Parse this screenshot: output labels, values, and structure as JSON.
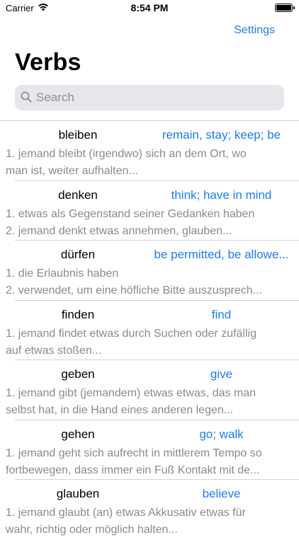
{
  "status_bar": {
    "carrier": "Carrier",
    "time": "8:54 PM"
  },
  "nav": {
    "settings_label": "Settings",
    "title": "Verbs"
  },
  "search": {
    "placeholder": "Search",
    "value": ""
  },
  "verbs": [
    {
      "word": "bleiben",
      "translation": "remain, stay; keep; be",
      "line1": "1. jemand bleibt (irgendwo) sich an dem Ort, wo",
      "line2": "man ist, weiter aufhalten..."
    },
    {
      "word": "denken",
      "translation": "think; have in mind",
      "line1": "1. etwas als Gegenstand seiner Gedanken haben",
      "line2": "2. jemand denkt etwas annehmen, glauben..."
    },
    {
      "word": "dürfen",
      "translation": "be permitted, be allowe...",
      "line1": "1. die Erlaubnis haben",
      "line2": "2. verwendet, um eine höfliche Bitte auszusprech..."
    },
    {
      "word": "finden",
      "translation": "find",
      "line1": "1. jemand findet etwas durch Suchen oder zufällig",
      "line2": "auf etwas stoßen..."
    },
    {
      "word": "geben",
      "translation": "give",
      "line1": "1. jemand gibt (jemandem) etwas etwas, das man",
      "line2": "selbst hat, in die Hand eines anderen legen..."
    },
    {
      "word": "gehen",
      "translation": "go; walk",
      "line1": "1. jemand geht sich aufrecht in mittlerem Tempo so",
      "line2": "fortbewegen, dass immer ein Fuß Kontakt mit de..."
    },
    {
      "word": "glauben",
      "translation": "believe",
      "line1": "1. jemand glaubt (an) etwas Akkusativ etwas für",
      "line2": "wahr, richtig oder möglich halten..."
    }
  ],
  "colors": {
    "accent": "#1a7df0",
    "secondary_text": "#8a8a8e",
    "search_bg": "#e7e7eb",
    "separator": "#d1d1d6"
  },
  "icons": {
    "search": "search-icon",
    "wifi": "wifi-icon",
    "battery": "battery-icon"
  }
}
